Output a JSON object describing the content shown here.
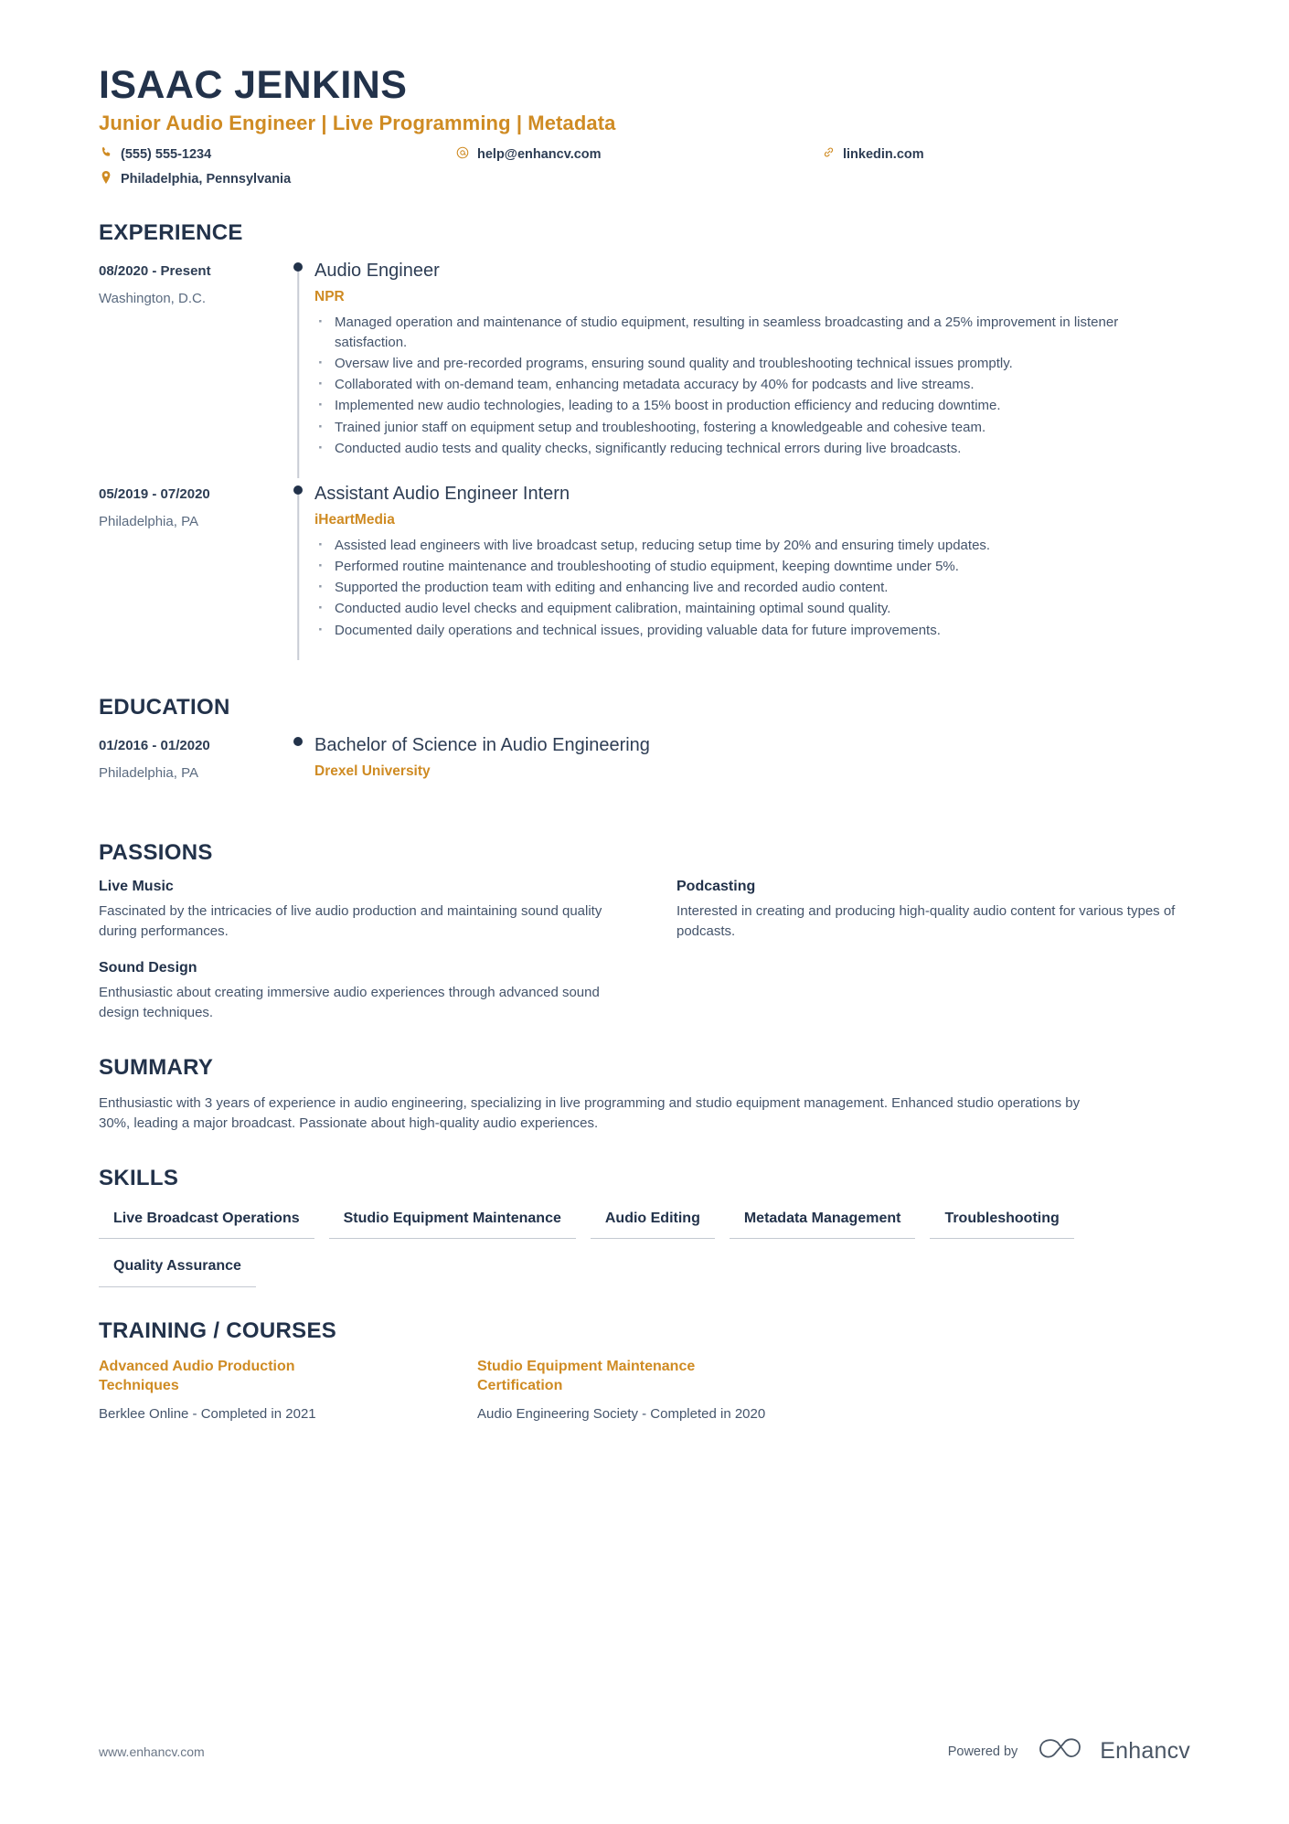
{
  "header": {
    "name": "ISAAC JENKINS",
    "headline": "Junior Audio Engineer | Live Programming | Metadata",
    "contacts": [
      {
        "icon": "phone-icon",
        "text": "(555) 555-1234"
      },
      {
        "icon": "email-icon",
        "text": "help@enhancv.com"
      },
      {
        "icon": "link-icon",
        "text": "linkedin.com"
      },
      {
        "icon": "location-icon",
        "text": "Philadelphia, Pennsylvania"
      }
    ]
  },
  "sections": {
    "experience": {
      "title": "EXPERIENCE",
      "entries": [
        {
          "date": "08/2020 - Present",
          "location": "Washington, D.C.",
          "title": "Audio Engineer",
          "company": "NPR",
          "bullets": [
            "Managed operation and maintenance of studio equipment, resulting in seamless broadcasting and a 25% improvement in listener satisfaction.",
            "Oversaw live and pre-recorded programs, ensuring sound quality and troubleshooting technical issues promptly.",
            "Collaborated with on-demand team, enhancing metadata accuracy by 40% for podcasts and live streams.",
            "Implemented new audio technologies, leading to a 15% boost in production efficiency and reducing downtime.",
            "Trained junior staff on equipment setup and troubleshooting, fostering a knowledgeable and cohesive team.",
            "Conducted audio tests and quality checks, significantly reducing technical errors during live broadcasts."
          ]
        },
        {
          "date": "05/2019 - 07/2020",
          "location": "Philadelphia, PA",
          "title": "Assistant Audio Engineer Intern",
          "company": "iHeartMedia",
          "bullets": [
            "Assisted lead engineers with live broadcast setup, reducing setup time by 20% and ensuring timely updates.",
            "Performed routine maintenance and troubleshooting of studio equipment, keeping downtime under 5%.",
            "Supported the production team with editing and enhancing live and recorded audio content.",
            "Conducted audio level checks and equipment calibration, maintaining optimal sound quality.",
            "Documented daily operations and technical issues, providing valuable data for future improvements."
          ]
        }
      ]
    },
    "education": {
      "title": "EDUCATION",
      "entries": [
        {
          "date": "01/2016 - 01/2020",
          "location": "Philadelphia, PA",
          "title": "Bachelor of Science in Audio Engineering",
          "company": "Drexel University"
        }
      ]
    },
    "passions": {
      "title": "PASSIONS",
      "items": [
        {
          "title": "Live Music",
          "desc": "Fascinated by the intricacies of live audio production and maintaining sound quality during performances."
        },
        {
          "title": "Podcasting",
          "desc": "Interested in creating and producing high-quality audio content for various types of podcasts."
        },
        {
          "title": "Sound Design",
          "desc": "Enthusiastic about creating immersive audio experiences through advanced sound design techniques."
        }
      ]
    },
    "summary": {
      "title": "SUMMARY",
      "text": "Enthusiastic with 3 years of experience in audio engineering, specializing in live programming and studio equipment management. Enhanced studio operations by 30%, leading a major broadcast. Passionate about high-quality audio experiences."
    },
    "skills": {
      "title": "SKILLS",
      "items": [
        "Live Broadcast Operations",
        "Studio Equipment Maintenance",
        "Audio Editing",
        "Metadata Management",
        "Troubleshooting",
        "Quality Assurance"
      ]
    },
    "training": {
      "title": "TRAINING / COURSES",
      "items": [
        {
          "title": "Advanced Audio Production Techniques",
          "meta": "Berklee Online - Completed in 2021"
        },
        {
          "title": "Studio Equipment Maintenance Certification",
          "meta": "Audio Engineering Society - Completed in 2020"
        }
      ]
    }
  },
  "footer": {
    "url": "www.enhancv.com",
    "powered_by": "Powered by",
    "brand": "Enhancv"
  },
  "colors": {
    "accent": "#cf8b23",
    "heading": "#22324a",
    "body": "#44546b"
  }
}
